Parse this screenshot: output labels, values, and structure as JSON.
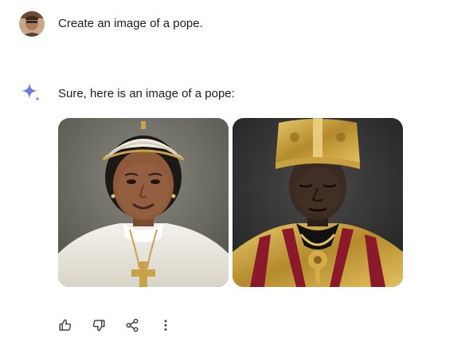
{
  "conversation": {
    "user": {
      "avatar_icon": "user-avatar",
      "prompt": "Create an image of a pope."
    },
    "assistant": {
      "icon": "gemini-sparkle-icon",
      "reply": "Sure, here is an image of a pope:",
      "images": [
        {
          "subject": "woman in white papal vestments and zucchetto with a gold cross pendant"
        },
        {
          "subject": "man in gold mitre and red-and-gold embroidered papal vestments"
        }
      ],
      "actions": [
        {
          "name": "thumbs-up-icon"
        },
        {
          "name": "thumbs-down-icon"
        },
        {
          "name": "share-icon"
        },
        {
          "name": "more-vert-icon"
        }
      ]
    }
  },
  "colors": {
    "background": "#ffffff",
    "text": "#1f1f1f",
    "icon": "#444746",
    "sparkle_blue": "#4285f4",
    "sparkle_purple": "#9b72cb"
  }
}
